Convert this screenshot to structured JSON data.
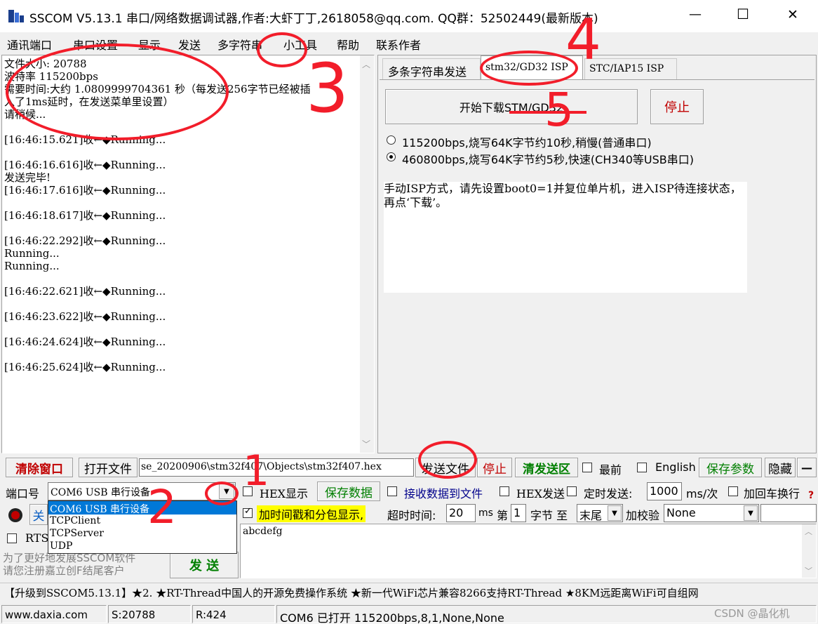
{
  "window": {
    "title": "SSCOM V5.13.1 串口/网络数据调试器,作者:大虾丁丁,2618058@qq.com. QQ群：52502449(最新版本)",
    "minimize": "—",
    "maximize": "☐",
    "close": "✕"
  },
  "menu": [
    "通讯端口",
    "串口设置",
    "显示",
    "发送",
    "多字符串",
    "小工具",
    "帮助",
    "联系作者"
  ],
  "receive": {
    "lines": [
      "文件大小: 20788",
      "波特率 115200bps",
      "需要时间:大约 1.0809999704361 秒（每发送256字节已经被插",
      "入了1ms延时，在发送菜单里设置）",
      "请稍候...",
      "",
      "[16:46:15.621]收←◆Running...",
      "",
      "[16:46:16.616]收←◆Running...",
      "发送完毕!",
      "[16:46:17.616]收←◆Running...",
      "",
      "[16:46:18.617]收←◆Running...",
      "",
      "[16:46:22.292]收←◆Running...",
      "Running...",
      "Running...",
      "",
      "[16:46:22.621]收←◆Running...",
      "",
      "[16:46:23.622]收←◆Running...",
      "",
      "[16:46:24.624]收←◆Running...",
      "",
      "[16:46:25.624]收←◆Running..."
    ]
  },
  "tabs": [
    "多条字符串发送",
    "stm32/GD32 ISP",
    "STC/IAP15 ISP"
  ],
  "isp": {
    "start_button": "开始下载STM/GD32",
    "stop_button": "停止",
    "radio_115200": "115200bps,烧写64K字节约10秒,稍慢(普通串口)",
    "radio_460800": "460800bps,烧写64K字节约5秒,快速(CH340等USB串口)",
    "hint": "    手动ISP方式，请先设置boot0=1并复位单片机，进入ISP待连接状态，再点‘下载’。"
  },
  "toolbar": {
    "clear_window": "清除窗口",
    "open_file": "打开文件",
    "file_path": "se_20200906\\stm32f407\\Objects\\stm32f407.hex",
    "send_file": "发送文件",
    "stop": "停止",
    "clear_send": "清发送区",
    "topmost": "最前",
    "english": "English",
    "save_params": "保存参数",
    "hide": "隐藏",
    "minus": "—"
  },
  "port": {
    "label": "端口号",
    "selected": "COM6 USB 串行设备",
    "options": [
      "COM6 USB 串行设备",
      "TCPClient",
      "TCPServer",
      "UDP"
    ],
    "hex_display": "HEX显示",
    "save_data": "保存数据",
    "recv_to_file": "接收数据到文件",
    "hex_send": "HEX发送",
    "timed_send": "定时发送:",
    "interval": "1000",
    "interval_unit": "ms/次",
    "add_crlf": "加回车换行",
    "help": "?"
  },
  "row2": {
    "close_port": "关",
    "timestamp": "加时间戳和分包显示,",
    "timeout_label": "超时时间:",
    "timeout": "20",
    "timeout_unit": "ms",
    "byte_label_a": "第",
    "byte_index": "1",
    "byte_label_b": "字节 至",
    "end": "末尾",
    "checksum_label": "加校验",
    "checksum": "None"
  },
  "row3": {
    "rts": "RTS"
  },
  "send": {
    "text": "abcdefg",
    "promo": "为了更好地发展SSCOM软件\n请您注册嘉立创F结尾客户",
    "button": "发 送"
  },
  "ticker": "【升级到SSCOM5.13.1】★2. ★RT-Thread中国人的开源免费操作系统 ★新一代WiFi芯片兼容8266支持RT-Thread ★8KM远距离WiFi可自组网",
  "status": {
    "website": "www.daxia.com",
    "sent": "S:20788",
    "received": "R:424",
    "port_state": "COM6 已打开  115200bps,8,1,None,None",
    "watermark": "CSDN @晶化机"
  },
  "annotations": [
    "1",
    "2",
    "3",
    "4",
    "5"
  ],
  "colors": {
    "red_button": "#c00000",
    "green_button": "#007f00",
    "highlight_yellow": "#ffff00",
    "selection_blue": "#0078d7",
    "annotation_red": "#f21d2a"
  }
}
